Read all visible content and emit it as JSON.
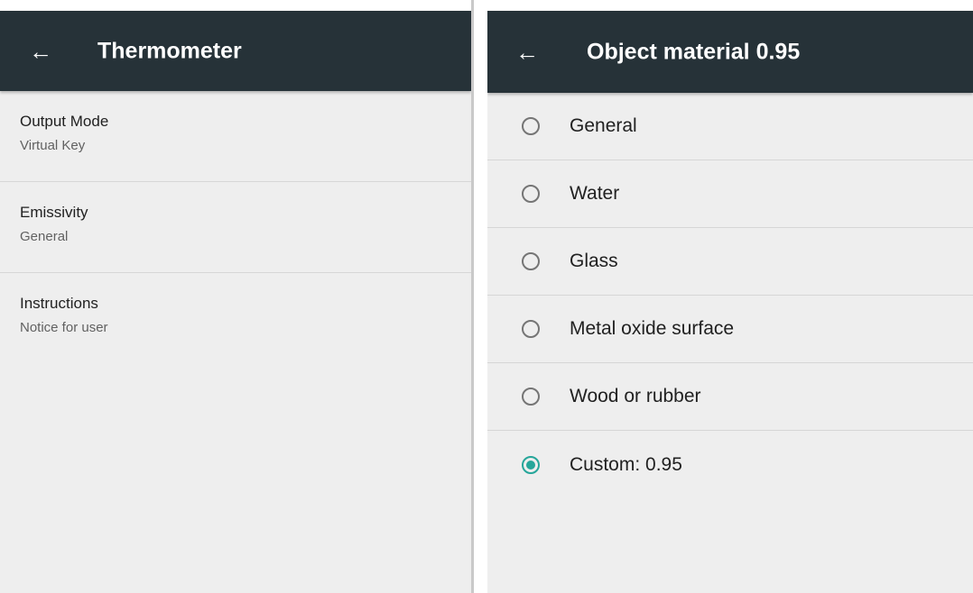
{
  "left": {
    "title": "Thermometer",
    "items": [
      {
        "title": "Output Mode",
        "summary": "Virtual Key"
      },
      {
        "title": "Emissivity",
        "summary": "General"
      },
      {
        "title": "Instructions",
        "summary": "Notice for user"
      }
    ]
  },
  "right": {
    "title": "Object material 0.95",
    "options": [
      {
        "label": "General",
        "checked": false
      },
      {
        "label": "Water",
        "checked": false
      },
      {
        "label": "Glass",
        "checked": false
      },
      {
        "label": "Metal oxide surface",
        "checked": false
      },
      {
        "label": "Wood or rubber",
        "checked": false
      },
      {
        "label": "Custom: 0.95",
        "checked": true
      }
    ]
  },
  "icons": {
    "back": "back-arrow-icon",
    "radio": "radio-button-icon"
  },
  "colors": {
    "app_bar": "#263238",
    "accent": "#26a69a",
    "background": "#eeeeee"
  }
}
